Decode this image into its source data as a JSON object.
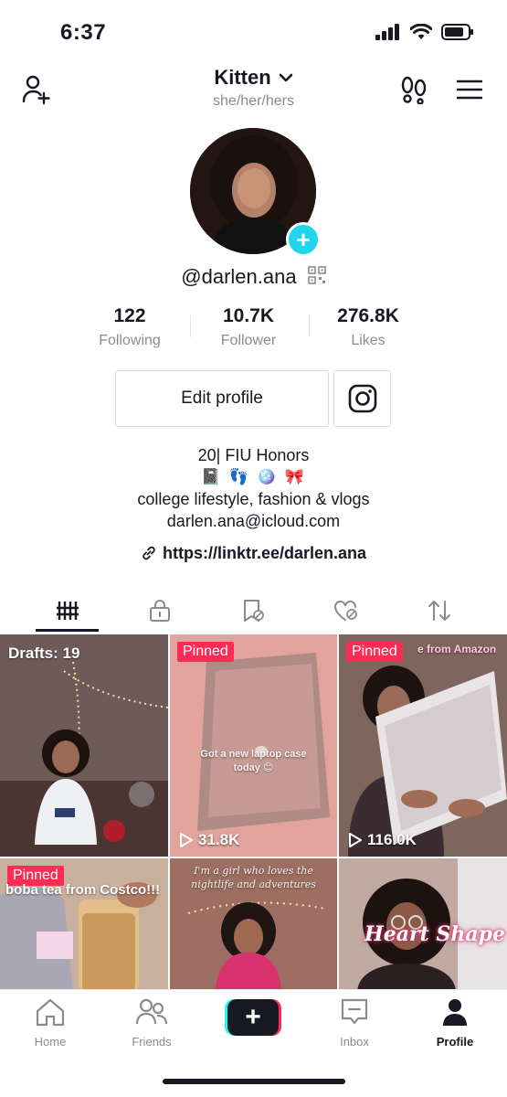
{
  "status_bar": {
    "time": "6:37"
  },
  "header": {
    "title": "Kitten",
    "pronouns": "she/her/hers"
  },
  "profile": {
    "username": "@darlen.ana"
  },
  "stats": [
    {
      "value": "122",
      "label": "Following"
    },
    {
      "value": "10.7K",
      "label": "Follower"
    },
    {
      "value": "276.8K",
      "label": "Likes"
    }
  ],
  "actions": {
    "edit_profile": "Edit profile"
  },
  "bio": {
    "line1": "20| FIU Honors",
    "emojis": "📓 👣 🪩 🎀",
    "line3": "college lifestyle, fashion & vlogs",
    "line4": "darlen.ana@icloud.com"
  },
  "link": "https://linktr.ee/darlen.ana",
  "videos": [
    {
      "badge": "Drafts: 19",
      "views": ""
    },
    {
      "badge": "Pinned",
      "caption": "Got a new laptop case today 😊",
      "views": "31.8K"
    },
    {
      "badge": "Pinned",
      "caption": "e from Amazon",
      "views": "116.0K"
    },
    {
      "badge": "Pinned",
      "caption": "boba tea from Costco!!!"
    },
    {
      "caption": "I'm a girl who loves the nightlife and adventures"
    },
    {
      "caption": "Heart Shape"
    }
  ],
  "nav": [
    {
      "label": "Home"
    },
    {
      "label": "Friends"
    },
    {
      "label": "Inbox"
    },
    {
      "label": "Profile"
    }
  ],
  "colors": {
    "accent": "#fe2c55",
    "cyan": "#25f4ee",
    "add_badge": "#20d5ec"
  }
}
